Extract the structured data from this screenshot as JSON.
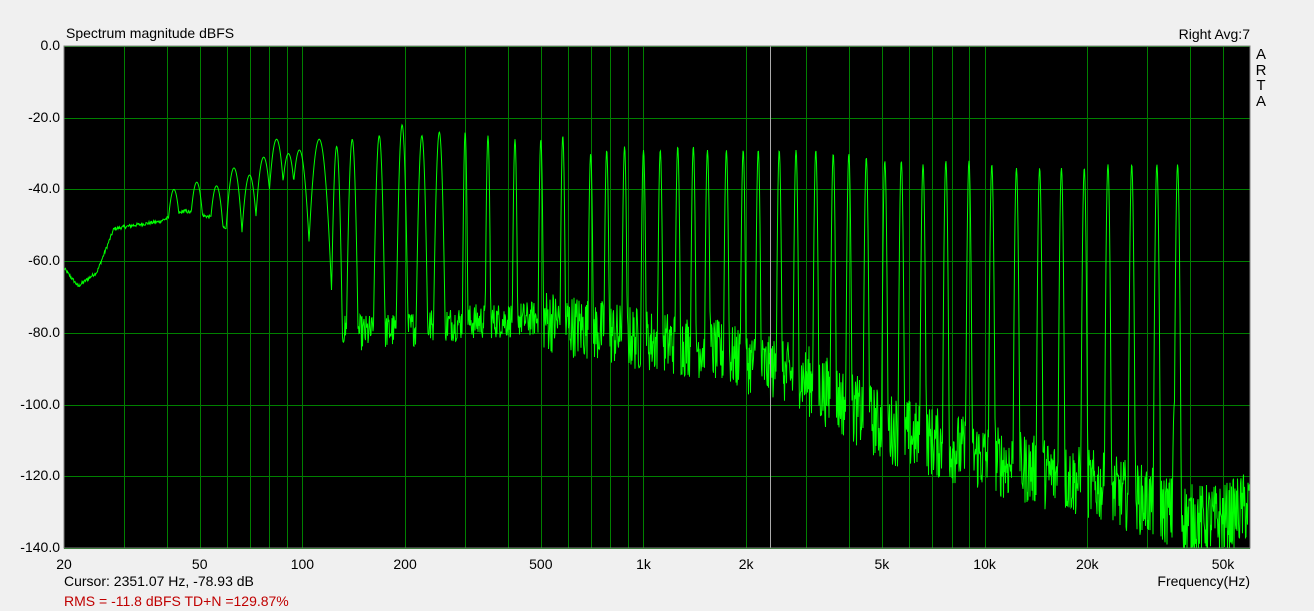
{
  "header": {
    "title": "Spectrum magnitude dBFS",
    "channel": "Right  Avg:7",
    "logo": [
      "A",
      "R",
      "T",
      "A"
    ]
  },
  "footer": {
    "cursor": "Cursor: 2351.07 Hz, -78.93 dB",
    "rms": "RMS =  -11.8 dBFS   TD+N =129.87%",
    "xlabel": "Frequency(Hz)"
  },
  "colors": {
    "plot_bg": "#000000",
    "grid": "#008000",
    "trace": "#00ff00",
    "cursor": "#aaaaaa",
    "axis": "#808080",
    "rms_text": "#c00000"
  },
  "chart_data": {
    "type": "line",
    "title": "Spectrum magnitude dBFS",
    "xlabel": "Frequency(Hz)",
    "ylabel": "",
    "x_scale": "log",
    "xlim": [
      20,
      60000
    ],
    "ylim": [
      -140,
      0
    ],
    "grid": true,
    "cursor_x": 2351.07,
    "y_ticks": [
      "0.0",
      "-20.0",
      "-40.0",
      "-60.0",
      "-80.0",
      "-100.0",
      "-120.0",
      "-140.0"
    ],
    "x_ticks": [
      {
        "value": 20,
        "label": "20"
      },
      {
        "value": 50,
        "label": "50"
      },
      {
        "value": 100,
        "label": "100"
      },
      {
        "value": 200,
        "label": "200"
      },
      {
        "value": 500,
        "label": "500"
      },
      {
        "value": 1000,
        "label": "1k"
      },
      {
        "value": 2000,
        "label": "2k"
      },
      {
        "value": 5000,
        "label": "5k"
      },
      {
        "value": 10000,
        "label": "10k"
      },
      {
        "value": 20000,
        "label": "20k"
      },
      {
        "value": 50000,
        "label": "50k"
      }
    ],
    "series": [
      {
        "floor": [
          [
            20,
            -62
          ],
          [
            22,
            -67
          ],
          [
            25,
            -63
          ],
          [
            28,
            -51
          ],
          [
            32,
            -50
          ],
          [
            38,
            -49
          ],
          [
            45,
            -46
          ],
          [
            55,
            -48
          ],
          [
            70,
            -58
          ],
          [
            90,
            -68
          ],
          [
            110,
            -78
          ],
          [
            150,
            -80
          ],
          [
            200,
            -79
          ],
          [
            300,
            -77
          ],
          [
            500,
            -76
          ],
          [
            700,
            -79
          ],
          [
            1000,
            -82
          ],
          [
            1500,
            -84
          ],
          [
            2000,
            -88
          ],
          [
            3000,
            -93
          ],
          [
            5000,
            -106
          ],
          [
            8000,
            -112
          ],
          [
            12000,
            -117
          ],
          [
            20000,
            -122
          ],
          [
            30000,
            -127
          ],
          [
            40000,
            -132
          ],
          [
            50000,
            -132
          ],
          [
            60000,
            -128
          ]
        ],
        "peaks": [
          [
            42,
            -40
          ],
          [
            49,
            -38
          ],
          [
            56,
            -39
          ],
          [
            63,
            -34
          ],
          [
            70,
            -36
          ],
          [
            77,
            -31
          ],
          [
            84,
            -26
          ],
          [
            91,
            -30
          ],
          [
            98,
            -29
          ],
          [
            112,
            -26
          ],
          [
            126,
            -28
          ],
          [
            140,
            -26
          ],
          [
            168,
            -25
          ],
          [
            196,
            -22
          ],
          [
            224,
            -25
          ],
          [
            252,
            -24
          ],
          [
            300,
            -24
          ],
          [
            350,
            -25
          ],
          [
            420,
            -26
          ],
          [
            500,
            -26
          ],
          [
            580,
            -25
          ],
          [
            700,
            -30
          ],
          [
            780,
            -29
          ],
          [
            880,
            -28
          ],
          [
            1000,
            -29
          ],
          [
            1120,
            -29
          ],
          [
            1260,
            -28
          ],
          [
            1400,
            -28
          ],
          [
            1540,
            -29
          ],
          [
            1750,
            -29
          ],
          [
            1960,
            -29
          ],
          [
            2170,
            -29
          ],
          [
            2500,
            -29
          ],
          [
            2800,
            -29
          ],
          [
            3200,
            -29
          ],
          [
            3600,
            -30
          ],
          [
            4000,
            -30
          ],
          [
            4500,
            -31
          ],
          [
            5100,
            -32
          ],
          [
            5700,
            -32
          ],
          [
            6600,
            -33
          ],
          [
            7700,
            -32
          ],
          [
            9000,
            -32
          ],
          [
            10500,
            -33
          ],
          [
            12400,
            -34
          ],
          [
            14500,
            -34
          ],
          [
            16800,
            -34
          ],
          [
            19600,
            -34
          ],
          [
            23000,
            -33
          ],
          [
            27000,
            -33
          ],
          [
            32000,
            -33
          ],
          [
            36800,
            -33
          ],
          [
            36000,
            -100
          ]
        ]
      }
    ]
  }
}
